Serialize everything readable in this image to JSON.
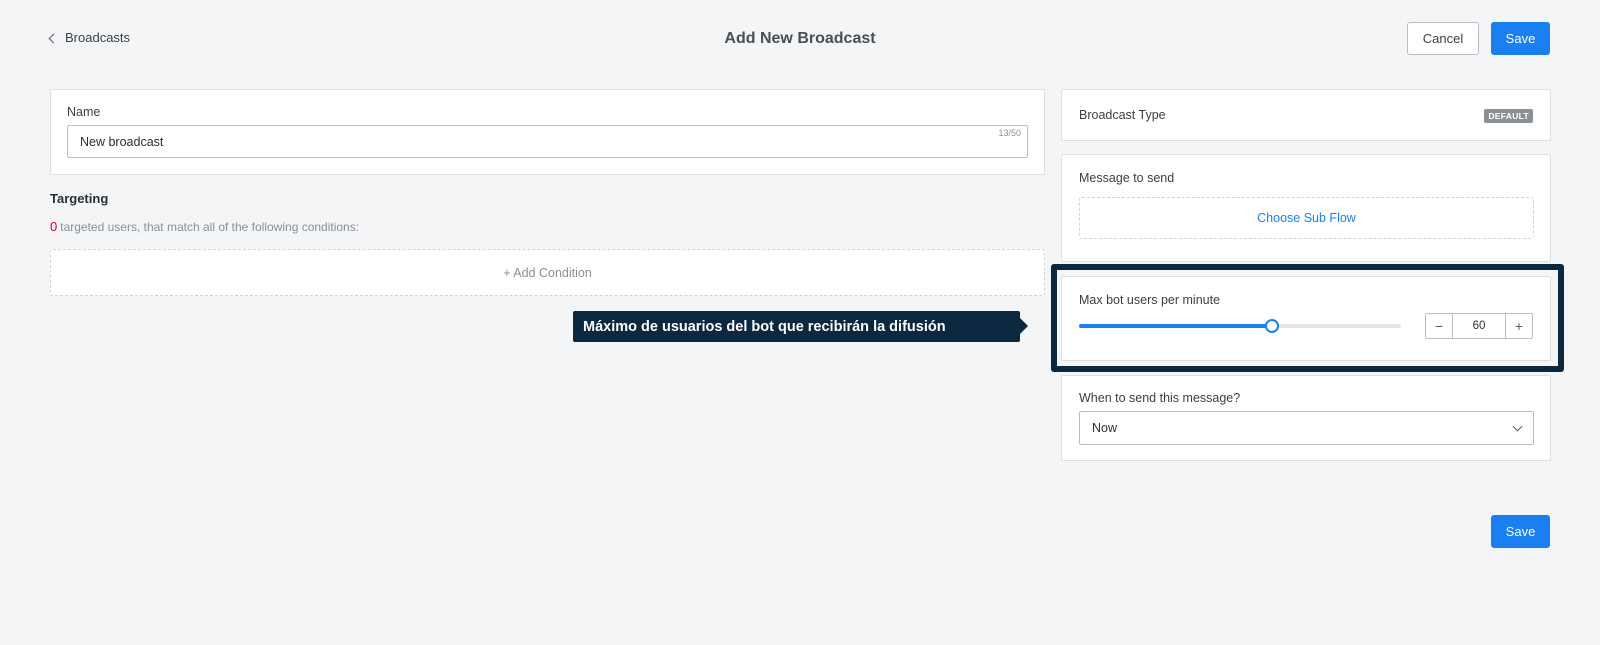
{
  "header": {
    "back_label": "Broadcasts",
    "title": "Add New Broadcast",
    "cancel_label": "Cancel",
    "save_label": "Save"
  },
  "name_section": {
    "label": "Name",
    "value": "New broadcast",
    "counter": "13/50"
  },
  "targeting": {
    "title": "Targeting",
    "count": "0",
    "description": "targeted users, that match all of the following conditions:",
    "add_condition_label": "+ Add Condition"
  },
  "tooltip": {
    "text": "Máximo de usuarios del bot que recibirán la difusión"
  },
  "broadcast_type": {
    "label": "Broadcast Type",
    "badge": "DEFAULT"
  },
  "message": {
    "label": "Message to send",
    "choose_label": "Choose Sub Flow"
  },
  "max_users": {
    "label": "Max bot users per minute",
    "value": "60",
    "slider_fraction": 0.6,
    "minus": "−",
    "plus": "+"
  },
  "schedule": {
    "label": "When to send this message?",
    "selected": "Now"
  },
  "footer": {
    "save_label": "Save"
  },
  "colors": {
    "accent": "#1a7ff0",
    "highlight": "#0c2740",
    "count_red": "#d0021b"
  }
}
